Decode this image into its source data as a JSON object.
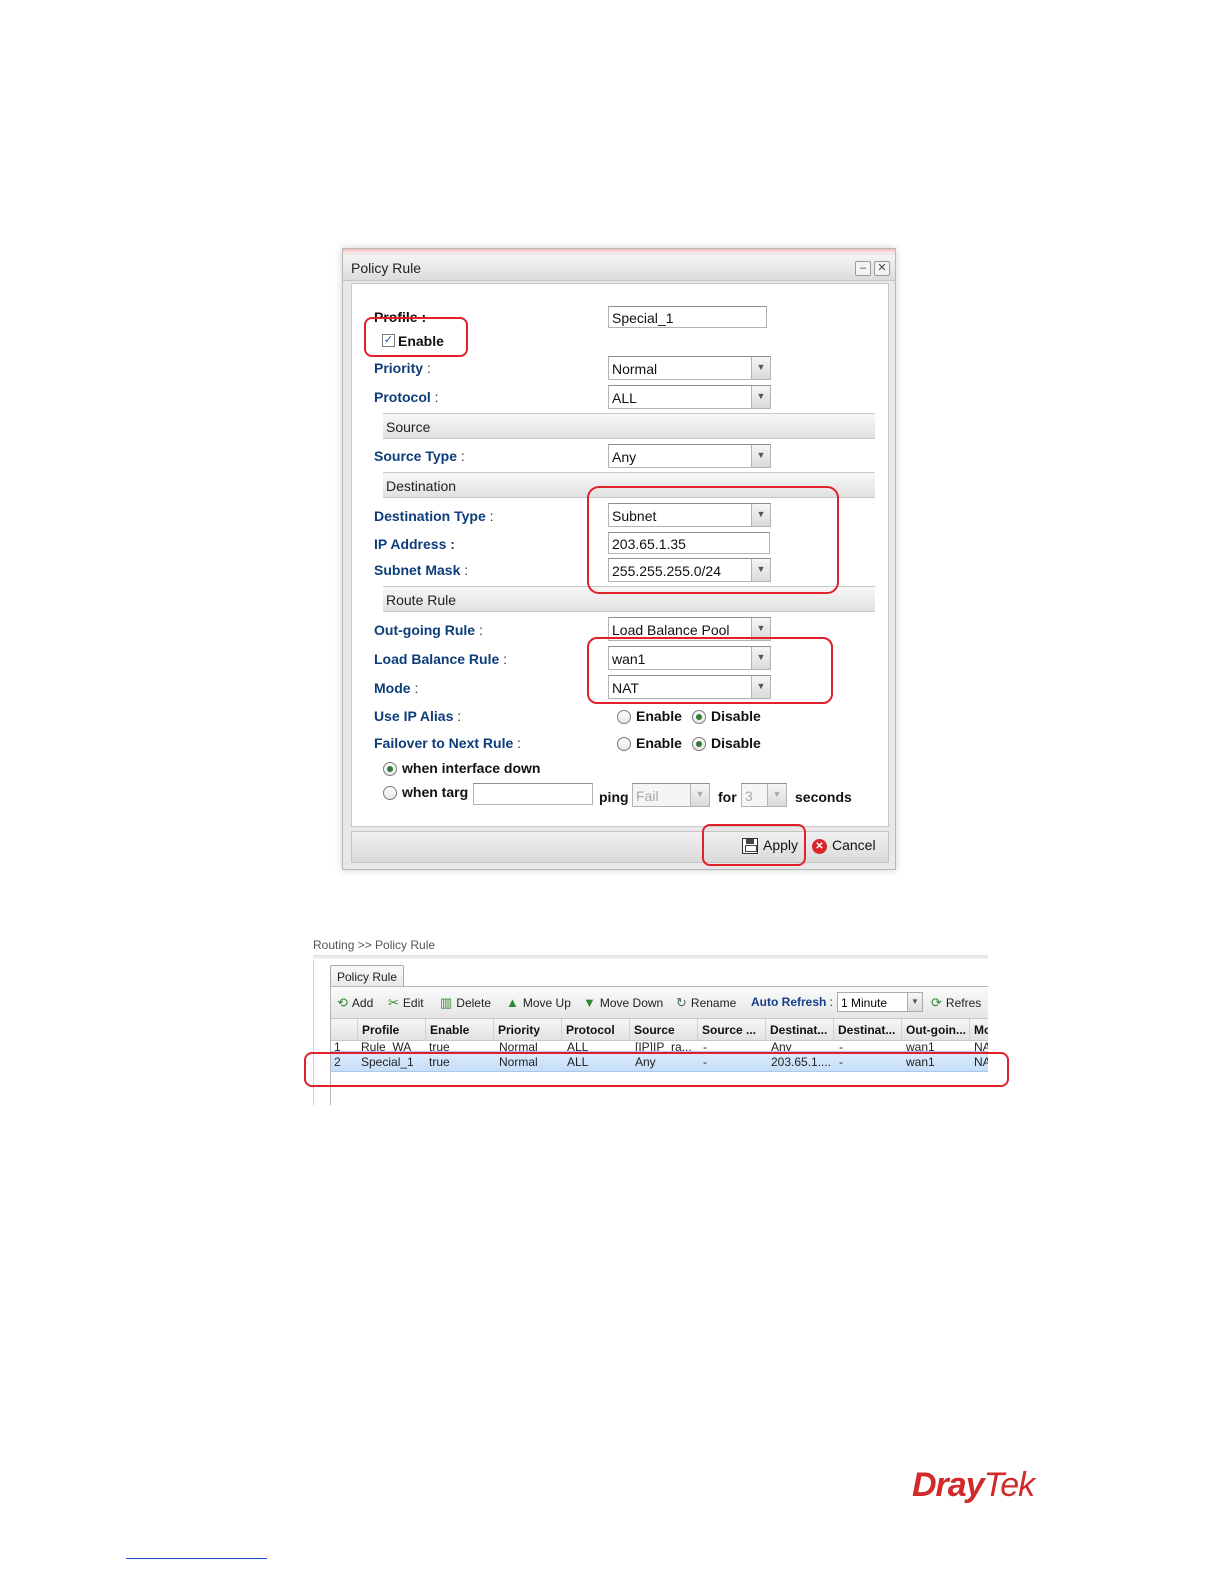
{
  "dialog": {
    "title": "Policy Rule",
    "min_icon": "–",
    "close_icon": "✕",
    "fields": {
      "profile_label": "Profile :",
      "profile_value": "Special_1",
      "enable_label": "Enable",
      "enable_checked": true,
      "priority_label": "Priority",
      "priority_value": "Normal",
      "protocol_label": "Protocol",
      "protocol_value": "ALL"
    },
    "source": {
      "section": "Source",
      "type_label": "Source Type",
      "type_value": "Any"
    },
    "destination": {
      "section": "Destination",
      "type_label": "Destination Type",
      "type_value": "Subnet",
      "ip_label": "IP Address :",
      "ip_value": "203.65.1.35",
      "mask_label": "Subnet Mask",
      "mask_value": "255.255.255.0/24"
    },
    "route": {
      "section": "Route Rule",
      "outgoing_label": "Out-going Rule",
      "outgoing_value": "Load Balance Pool",
      "lb_label": "Load Balance Rule",
      "lb_value": "wan1",
      "mode_label": "Mode",
      "mode_value": "NAT",
      "alias_label": "Use IP Alias",
      "failover_label": "Failover to Next Rule",
      "enable_option": "Enable",
      "disable_option": "Disable",
      "when_down": "when interface down",
      "when_target": "when targ",
      "ping_label": "ping",
      "ping_value": "Fail",
      "for_label": "for",
      "for_value": "3",
      "seconds_label": "seconds"
    },
    "buttons": {
      "apply": "Apply",
      "cancel": "Cancel",
      "cancel_icon": "✕"
    }
  },
  "table_panel": {
    "breadcrumb": "Routing >> Policy Rule",
    "tab": "Policy Rule",
    "toolbar": {
      "add": "Add",
      "edit": "Edit",
      "delete": "Delete",
      "move_up": "Move Up",
      "move_down": "Move Down",
      "rename": "Rename",
      "auto_refresh": "Auto Refresh",
      "refresh_interval": "1 Minute",
      "refresh": "Refres"
    },
    "columns": [
      "Profile",
      "Enable",
      "Priority",
      "Protocol",
      "Source",
      "Source ...",
      "Destinat...",
      "Destinat...",
      "Out-goin...",
      "Mo"
    ],
    "rows": [
      [
        "1",
        "Rule_WA",
        "true",
        "Normal",
        "ALL",
        "[IP]IP_ra...",
        "-",
        "Any",
        "-",
        "wan1",
        "NA"
      ],
      [
        "2",
        "Special_1",
        "true",
        "Normal",
        "ALL",
        "Any",
        "-",
        "203.65.1....",
        "-",
        "wan1",
        "NA"
      ]
    ]
  },
  "brand": {
    "name_a": "Dray",
    "name_b": "Tek",
    "color": "#d02a2a"
  }
}
